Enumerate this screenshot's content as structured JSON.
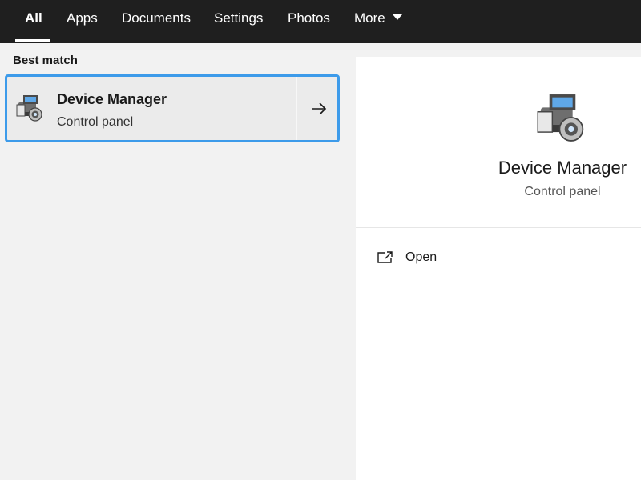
{
  "tabs": [
    {
      "label": "All"
    },
    {
      "label": "Apps"
    },
    {
      "label": "Documents"
    },
    {
      "label": "Settings"
    },
    {
      "label": "Photos"
    },
    {
      "label": "More"
    }
  ],
  "active_tab": "All",
  "results": {
    "section_label": "Best match",
    "best_match": {
      "title": "Device Manager",
      "subtitle": "Control panel",
      "icon": "device-manager-icon"
    }
  },
  "details": {
    "title": "Device Manager",
    "subtitle": "Control panel",
    "icon": "device-manager-icon",
    "actions": [
      {
        "label": "Open",
        "icon": "open-icon"
      }
    ]
  },
  "colors": {
    "topbar": "#1f1f1f",
    "selection_border": "#3d9bea",
    "pane_bg": "#f2f2f2",
    "detail_bg": "#ffffff"
  }
}
